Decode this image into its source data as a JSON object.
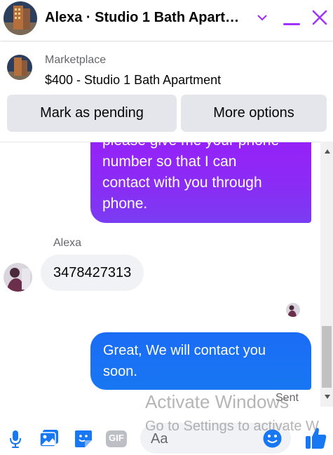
{
  "header": {
    "title": "Alexa · Studio 1 Bath Apart…",
    "icons": [
      "chevron-down-icon",
      "minimize-icon",
      "close-icon"
    ],
    "accent": "#a033ff"
  },
  "marketplace": {
    "label": "Marketplace",
    "listing": "$400 - Studio 1 Bath Apartment",
    "pending_button": "Mark as pending",
    "more_button": "More options"
  },
  "messages": {
    "outgoing_1": [
      "please give me your phone",
      "number so that I can",
      "contact with you through",
      "phone."
    ],
    "sender_name": "Alexa",
    "incoming_1": "3478427313",
    "outgoing_2": [
      "Great, We will contact you",
      "soon."
    ],
    "status": "Sent"
  },
  "composer": {
    "placeholder": "Aa",
    "icons": [
      "microphone-icon",
      "photo-icon",
      "sticker-icon",
      "gif-icon",
      "emoji-icon",
      "thumbs-up-icon"
    ],
    "gif_label": "GIF",
    "accent": "#1877f2"
  },
  "watermark": {
    "line1": "Activate Windows",
    "line2": "Go to Settings to activate W"
  }
}
